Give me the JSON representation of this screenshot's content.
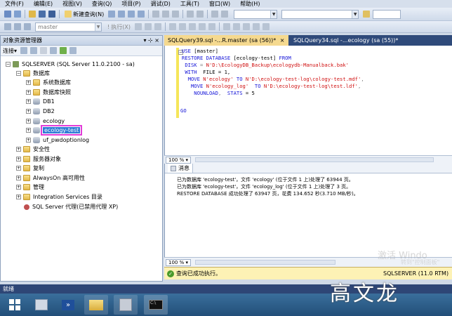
{
  "menu": [
    "文件(F)",
    "编辑(E)",
    "视图(V)",
    "查询(Q)",
    "项目(P)",
    "调试(D)",
    "工具(T)",
    "窗口(W)",
    "帮助(H)"
  ],
  "toolbar": {
    "new_query_label": "新建查询(N)",
    "database_combo": "master",
    "execute_label": "执行(X)"
  },
  "object_explorer": {
    "title": "对象资源管理器",
    "pin_glyph": "▾ ⊹ ×",
    "connect_label": "连接▾",
    "server": "SQLSERVER (SQL Server 11.0.2100 - sa)",
    "databases_label": "数据库",
    "system_dbs": "系统数据库",
    "snapshots": "数据库快照",
    "dbs": [
      "DB1",
      "DB2",
      "ecology",
      "ecology-test",
      "uf_pwdoptionlog"
    ],
    "selected_db": "ecology-test",
    "security": "安全性",
    "server_objects": "服务器对象",
    "replication": "复制",
    "alwayson": "AlwaysOn 高可用性",
    "management": "管理",
    "integration": "Integration Services 目录",
    "agent": "SQL Server 代理(已禁用代理 XP)"
  },
  "tabs": [
    {
      "label": "SQLQuery39.sql -...R.master (sa (56))*",
      "active": true
    },
    {
      "label": "SQLQuery34.sql -...ecology (sa (55))*",
      "active": false
    }
  ],
  "code": {
    "line1_kw": "USE",
    "line1_rest": " [master]",
    "line2_kw": "RESTORE DATABASE",
    "line2_db": " [ecology-test] ",
    "line2_kw2": "FROM",
    "line3_kw": " DISK",
    "line3_rest": " = ",
    "line3_str": "N'D:\\EcologyDB_Backup\\ecologydb-Manualback.bak'",
    "line4_kw": " WITH",
    "line4_rest": "  FILE = 1,",
    "line5_kw": "  MOVE",
    "line5_str1": " N'ecology'",
    "line5_kw2": " TO",
    "line5_str2": " N'D:\\ecology-test-log\\cology-test.mdf'",
    "line5_end": ",",
    "line6_kw": "   MOVE",
    "line6_str1": " N'ecology_log'",
    "line6_kw2": "  TO",
    "line6_str2": " N'D:\\ecology-test-log\\test.ldf'",
    "line6_end": ",",
    "line7_kw": "    NOUNLOAD",
    "line7_mid": ",  ",
    "line7_kw2": "STATS",
    "line7_end": " = 5",
    "line8": "GO"
  },
  "zoom": "100 %",
  "results": {
    "tab_label": "消息",
    "lines": [
      "已为数据库 'ecology-test'，文件 'ecology' (位于文件 1 上)处理了 63944 页。",
      "已为数据库 'ecology-test'，文件 'ecology_log' (位于文件 1 上)处理了 3 页。",
      "RESTORE DATABASE 成功处理了 63947 页，花费 134.652 秒(3.710 MB/秒)。"
    ]
  },
  "query_status": {
    "text": "查询已成功执行。",
    "server": "SQLSERVER (11.0 RTM)"
  },
  "watermark": {
    "line1": "激活 Windo",
    "line2": "转到\"控制面板\""
  },
  "status_bar": "就绪",
  "author_watermark": "高文龙",
  "colors": {
    "title_bar": "#2f4a7a",
    "active_tab": "#f5d98f",
    "keyword": "#1414d8",
    "string": "#d01010",
    "selection": "#e23cd8"
  }
}
